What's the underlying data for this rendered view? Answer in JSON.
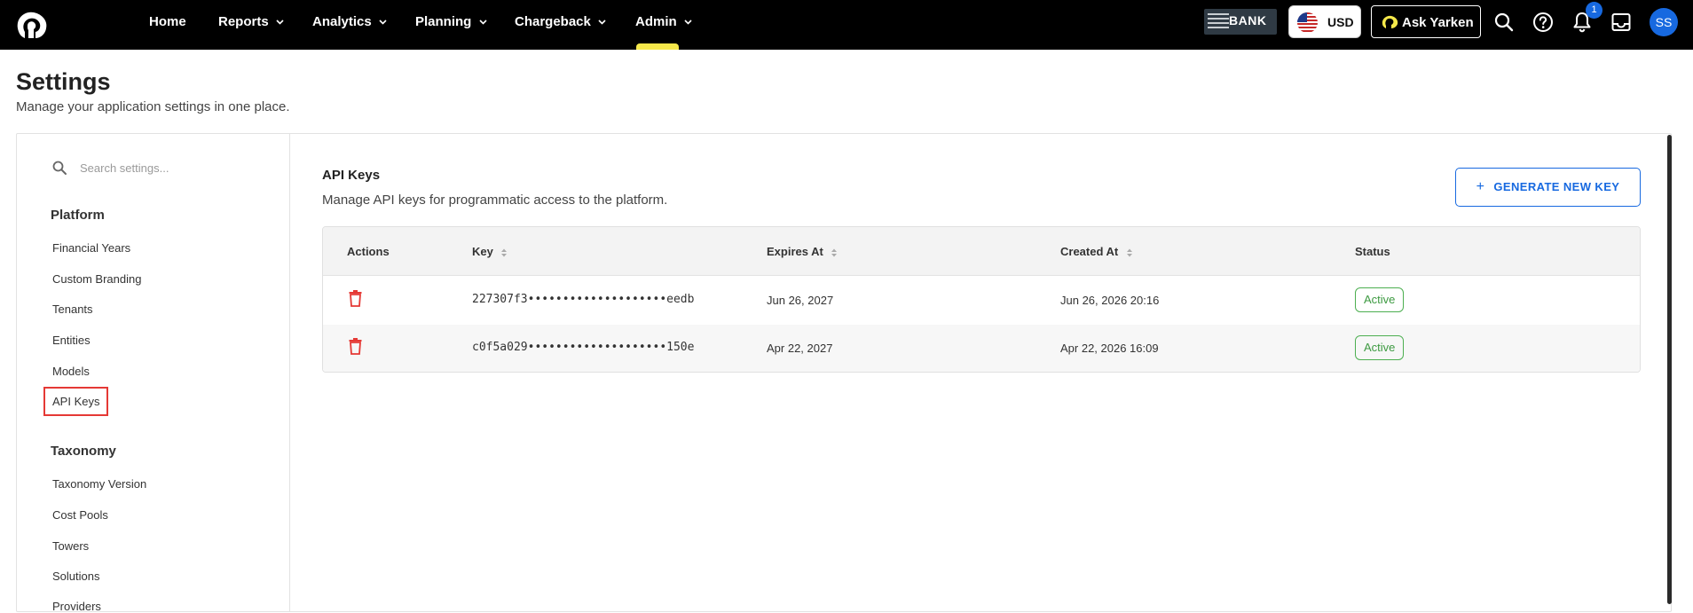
{
  "nav": {
    "items": [
      "Home",
      "Reports",
      "Analytics",
      "Planning",
      "Chargeback",
      "Admin"
    ],
    "active": "Admin",
    "accent_color": "#f5e84a"
  },
  "topbar": {
    "bank_logo_text": "BANK",
    "currency": "USD",
    "ask_label": "Ask Yarken",
    "notifications_count": "1",
    "avatar_initials": "SS",
    "icons": [
      "search-icon",
      "help-icon",
      "bell-icon",
      "inbox-icon"
    ]
  },
  "page": {
    "title": "Settings",
    "subtitle": "Manage your application settings in one place."
  },
  "sidebar": {
    "search_placeholder": "Search settings...",
    "sections": [
      {
        "title": "Platform",
        "items": [
          "Financial Years",
          "Custom Branding",
          "Tenants",
          "Entities",
          "Models",
          "API Keys"
        ]
      },
      {
        "title": "Taxonomy",
        "items": [
          "Taxonomy Version",
          "Cost Pools",
          "Towers",
          "Solutions",
          "Providers"
        ]
      }
    ],
    "selected": "API Keys"
  },
  "content": {
    "title": "API Keys",
    "description": "Manage API keys for programmatic access to the platform.",
    "generate_button": "GENERATE NEW KEY",
    "table": {
      "columns": [
        "Actions",
        "Key",
        "Expires At",
        "Created At",
        "Status"
      ],
      "rows": [
        {
          "key": "227307f3••••••••••••••••••••eedb",
          "expires_at": "Jun 26, 2027",
          "created_at": "Jun 26, 2026 20:16",
          "status": "Active"
        },
        {
          "key": "c0f5a029••••••••••••••••••••150e",
          "expires_at": "Apr 22, 2027",
          "created_at": "Apr 22, 2026 16:09",
          "status": "Active"
        }
      ]
    }
  },
  "colors": {
    "primary": "#1769e0",
    "danger": "#e53935",
    "success": "#4caf50",
    "topbar_bg": "#000000"
  }
}
